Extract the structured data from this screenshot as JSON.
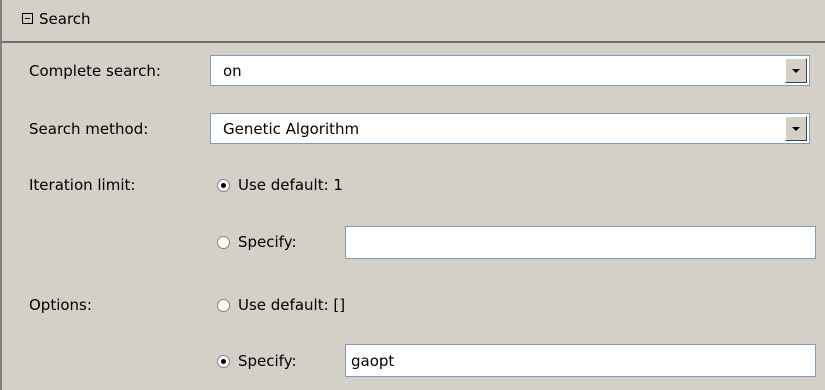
{
  "section": {
    "title": "Search"
  },
  "fields": {
    "complete_search": {
      "label": "Complete search:",
      "value": "on"
    },
    "search_method": {
      "label": "Search method:",
      "value": "Genetic Algorithm"
    },
    "iteration_limit": {
      "label": "Iteration limit:",
      "default_option": "Use default: 1",
      "default_checked": true,
      "specify_option": "Specify:",
      "specify_checked": false,
      "specify_value": ""
    },
    "options": {
      "label": "Options:",
      "default_option": "Use default: []",
      "default_checked": false,
      "specify_option": "Specify:",
      "specify_checked": true,
      "specify_value": "gaopt"
    }
  },
  "icons": {
    "collapse": "collapse-minus-icon",
    "dropdown": "chevron-down-icon"
  },
  "colors": {
    "panel_background": "#d4d0c8",
    "field_border": "#7f9db9"
  }
}
